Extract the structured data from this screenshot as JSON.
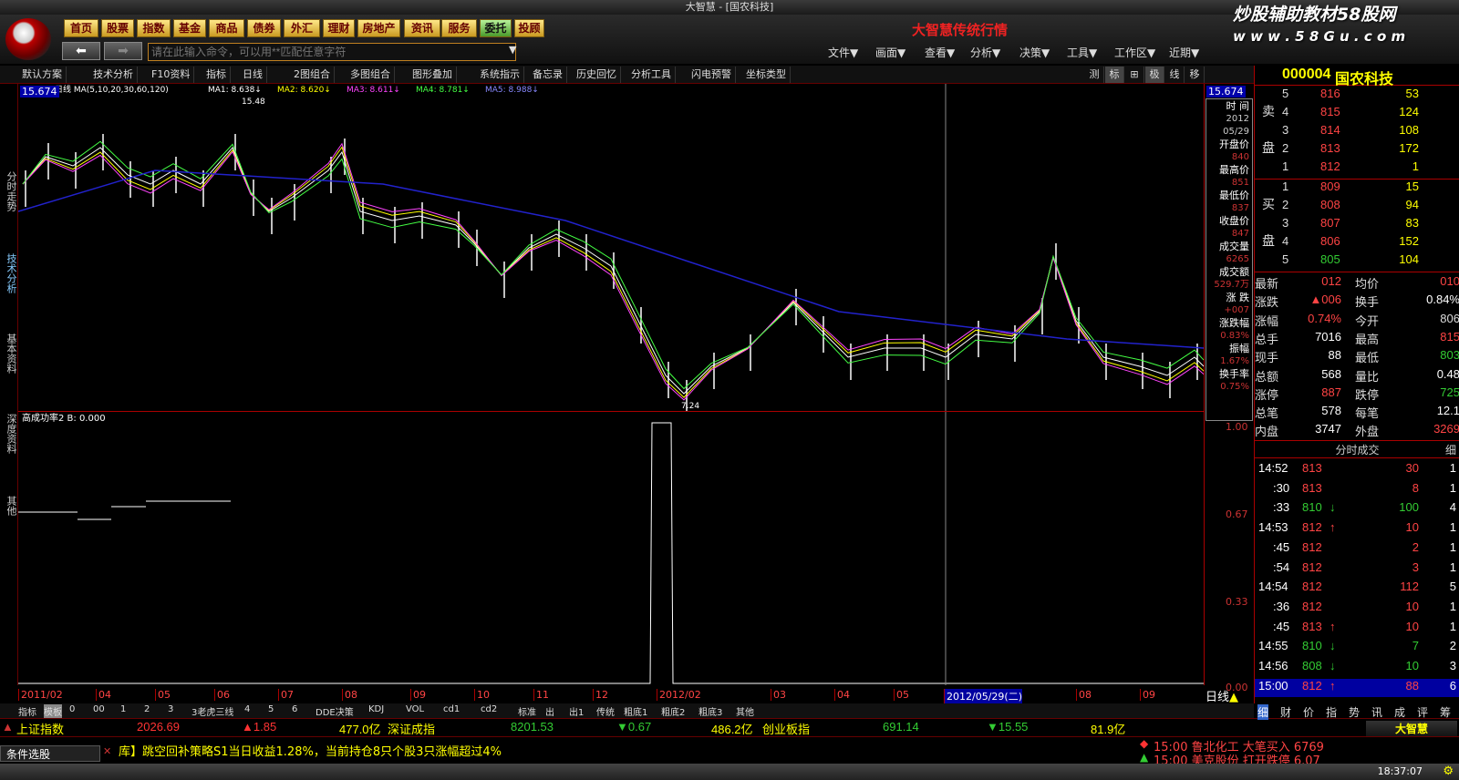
{
  "window": {
    "title": "大智慧 - [国农科技]"
  },
  "nav": [
    "首页",
    "股票",
    "指数",
    "基金",
    "商品",
    "债券",
    "外汇",
    "理财",
    "房地产",
    "资讯",
    "服务",
    "委托",
    "投顾"
  ],
  "command": {
    "placeholder": "请在此输入命令，可以用**匹配任意字符"
  },
  "brand": "大智慧传统行情",
  "watermark": {
    "line1": "炒股辅助教材58股网",
    "line2": "w w w . 5 8 G u . c o m"
  },
  "menus": [
    "文件▼",
    "画面▼",
    "查看▼",
    "分析▼",
    "决策▼",
    "工具▼",
    "工作区▼",
    "近期▼"
  ],
  "toolbar": [
    "默认方案",
    "技术分析",
    "F10资料",
    "指标",
    "日线",
    "2图组合",
    "多图组合",
    "图形叠加",
    "系统指示",
    "备忘录",
    "历史回忆",
    "分析工具",
    "闪电预警",
    "坐标类型"
  ],
  "toolbar_right": [
    "测",
    "标",
    "⊞",
    "极",
    "线",
    "移"
  ],
  "side_tabs": [
    "分时走势",
    "技术分析",
    "基本资料",
    "深度资料",
    "其他"
  ],
  "chart": {
    "ma_label": "日线 MA(5,10,20,30,60,120)",
    "ma_values": [
      "MA1: 8.638↓",
      "MA2: 8.620↓",
      "MA3: 8.611↓",
      "MA4: 8.781↓",
      "MA5: 8.988↓"
    ],
    "price_top": "15.674",
    "high_label": "15.48",
    "low_label": "7.24",
    "indicator_label": "高成功率2  B: 0.000",
    "ind_axis": [
      "1.00",
      "0.67",
      "0.33",
      "0.00"
    ],
    "colors": {
      "ma1": "#ffffff",
      "ma2": "#ffff00",
      "ma3": "#ff40ff",
      "ma4": "#40ff40",
      "ma5": "#8080ff",
      "ma6": "#2020c0"
    }
  },
  "info_panel": [
    {
      "label": "时 间",
      "value": "2012"
    },
    {
      "label": "",
      "value": "05/29"
    },
    {
      "label": "开盘价",
      "value": "840"
    },
    {
      "label": "最高价",
      "value": "851"
    },
    {
      "label": "最低价",
      "value": "837"
    },
    {
      "label": "收盘价",
      "value": "847"
    },
    {
      "label": "成交量",
      "value": "6265"
    },
    {
      "label": "成交额",
      "value": "529.7万"
    },
    {
      "label": "涨 跌",
      "value": "+007"
    },
    {
      "label": "涨跌幅",
      "value": "0.83%"
    },
    {
      "label": "振幅",
      "value": "1.67%"
    },
    {
      "label": "换手率",
      "value": "0.75%"
    }
  ],
  "stock": {
    "code": "000004",
    "name": "国农科技"
  },
  "asks": [
    [
      "5",
      "816",
      "53"
    ],
    [
      "4",
      "815",
      "124"
    ],
    [
      "3",
      "814",
      "108"
    ],
    [
      "2",
      "813",
      "172"
    ],
    [
      "1",
      "812",
      "1"
    ]
  ],
  "bids": [
    [
      "1",
      "809",
      "15"
    ],
    [
      "2",
      "808",
      "94"
    ],
    [
      "3",
      "807",
      "83"
    ],
    [
      "4",
      "806",
      "152"
    ],
    [
      "5",
      "805",
      "104"
    ]
  ],
  "ask_label": [
    "卖",
    "盘"
  ],
  "bid_label": [
    "买",
    "盘"
  ],
  "quote": [
    [
      "最新",
      "012",
      "均价",
      "010"
    ],
    [
      "涨跌",
      "▲006",
      "换手",
      "0.84%"
    ],
    [
      "涨幅",
      "0.74%",
      "今开",
      "806"
    ],
    [
      "总手",
      "7016",
      "最高",
      "815"
    ],
    [
      "现手",
      "88",
      "最低",
      "803"
    ],
    [
      "总额",
      "568",
      "量比",
      "0.48"
    ],
    [
      "涨停",
      "887",
      "跌停",
      "725"
    ],
    [
      "总笔",
      "578",
      "每笔",
      "12.1"
    ],
    [
      "内盘",
      "3747",
      "外盘",
      "3269"
    ]
  ],
  "ticks_header": "分时成交",
  "ticks": [
    [
      "14:52",
      "813",
      "",
      "30",
      "1"
    ],
    [
      ":30",
      "813",
      "",
      "8",
      "1"
    ],
    [
      ":33",
      "810",
      "↓",
      "100",
      "4"
    ],
    [
      "14:53",
      "812",
      "↑",
      "10",
      "1"
    ],
    [
      ":45",
      "812",
      "",
      "2",
      "1"
    ],
    [
      ":54",
      "812",
      "",
      "3",
      "1"
    ],
    [
      "14:54",
      "812",
      "",
      "112",
      "5"
    ],
    [
      ":36",
      "812",
      "",
      "10",
      "1"
    ],
    [
      ":45",
      "813",
      "↑",
      "10",
      "1"
    ],
    [
      "14:55",
      "810",
      "↓",
      "7",
      "2"
    ],
    [
      "14:56",
      "808",
      "↓",
      "10",
      "3"
    ],
    [
      "15:00",
      "812",
      "↑",
      "88",
      "6"
    ]
  ],
  "dates": [
    "2011/02",
    "04",
    "05",
    "06",
    "07",
    "08",
    "09",
    "10",
    "11",
    "12",
    "2012/02",
    "03",
    "04",
    "05",
    "2012/05/29(二)",
    "08",
    "09"
  ],
  "period": "日线",
  "bottom_tabs": [
    "指标",
    "模板",
    "0",
    "00",
    "1",
    "2",
    "3",
    "3老虎三线",
    "4",
    "5",
    "6",
    "DDE决策",
    "KDJ",
    "VOL",
    "cd1",
    "cd2",
    "标准",
    "出",
    "出1",
    "传统",
    "粗底1",
    "粗底2",
    "粗底3",
    "其他"
  ],
  "right_tabs": [
    "细",
    "财",
    "价",
    "指",
    "势",
    "讯",
    "成",
    "评",
    "筹"
  ],
  "status": {
    "sh_name": "上证指数",
    "sh_val": "2026.69",
    "sh_chg": "▲1.85",
    "sh_amt": "477.0亿",
    "sz_name": "深证成指",
    "sz_val": "8201.53",
    "sz_chg": "▼0.67",
    "sz_amt": "486.2亿",
    "cy_name": "创业板指",
    "cy_val": "691.14",
    "cy_chg": "▼15.55",
    "cy_amt": "81.9亿"
  },
  "scroll": {
    "left": "条件选股",
    "news": "库】跳空回补策略S1当日收益1.28%，当前持仓8只个股3只涨幅超过4%"
  },
  "alerts": [
    {
      "text": "15:00 鲁北化工 大笔买入 6769",
      "sign": "◆"
    },
    {
      "text": "15:00 美克股份 打开跌停 6.07",
      "sign": "▲"
    }
  ],
  "clock": "18:37:07",
  "app_logo": "大智慧"
}
